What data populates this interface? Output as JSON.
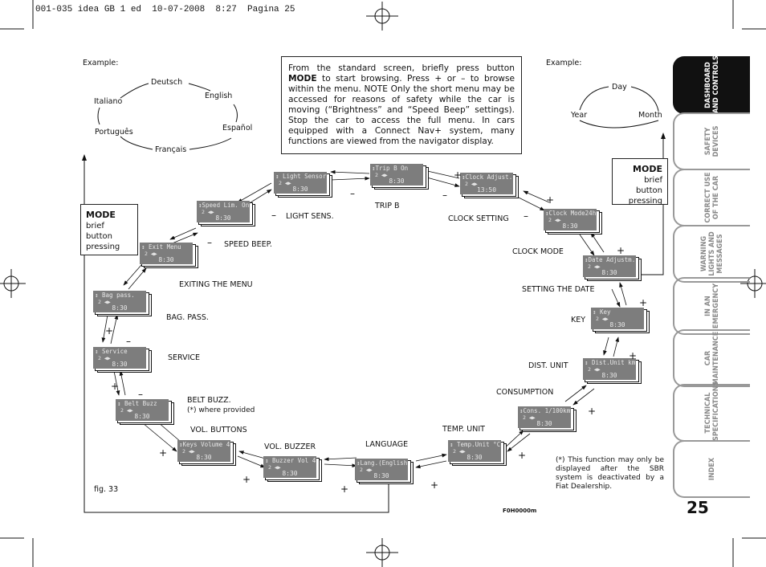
{
  "header": {
    "print_line": "001-035 idea GB 1 ed  10-07-2008  8:27  Pagina 25"
  },
  "info_box": {
    "text_before": "From the standard screen, briefly press button ",
    "mode": "MODE",
    "text_after": " to start browsing. Press + or – to browse within the menu. NOTE  Only the short menu may be accessed for reasons of safety while the car is moving (“Brightness” and “Speed Beep” settings). Stop the car to access the full menu. In cars equipped with a Connect Nav+ system, many functions are viewed from the navigator display."
  },
  "example_language": {
    "label": "Example:",
    "items": [
      "Deutsch",
      "English",
      "Español",
      "Français",
      "Português",
      "Italiano"
    ]
  },
  "example_date": {
    "label": "Example:",
    "items": [
      "Day",
      "Month",
      "Year"
    ]
  },
  "mode_boxes": [
    {
      "title": "MODE",
      "text": "brief button pressing"
    },
    {
      "title": "MODE",
      "text": "brief button pressing"
    }
  ],
  "displays": [
    {
      "id": "light-sensor",
      "line1": "↕ Light Sensor 2",
      "line2": "2 ◀▶",
      "time": "8:30",
      "caption": "LIGHT   SENS."
    },
    {
      "id": "trip-b",
      "line1": "↕Trip B      On",
      "line2": "2 ◀▶",
      "time": "8:30",
      "caption": "TRIP B"
    },
    {
      "id": "clock-adjust",
      "line1": "↕Clock Adjust.",
      "line2": "2 ◀▶",
      "time": "13:50",
      "caption": "CLOCK SETTING"
    },
    {
      "id": "clock-mode",
      "line1": "↕Clock Mode24h",
      "line2": "2 ◀▶",
      "time": "8:30",
      "caption": "CLOCK MODE"
    },
    {
      "id": "date-adjust",
      "line1": "↕Date Adjustm.",
      "line2": "2 ◀▶",
      "time": "8:30",
      "caption": "SETTING THE DATE"
    },
    {
      "id": "key",
      "line1": "↕       Key",
      "line2": "2 ◀▶",
      "time": "8:30",
      "caption": "KEY"
    },
    {
      "id": "dist-unit",
      "line1": "↕ Dist.Unit km",
      "line2": "2 ◀▶",
      "time": "8:30",
      "caption": "DIST. UNIT"
    },
    {
      "id": "consumption",
      "line1": "↕Cons. 1/100km",
      "line2": "2 ◀▶",
      "time": "8:30",
      "caption": "CONSUMPTION"
    },
    {
      "id": "temp-unit",
      "line1": "↕ Temp.Unit °C",
      "line2": "2 ◀▶",
      "time": "8:30",
      "caption": "TEMP. UNIT"
    },
    {
      "id": "language",
      "line1": "↕Lang.(English)",
      "line2": "2 ◀▶",
      "time": "8:30",
      "caption": "LANGUAGE"
    },
    {
      "id": "buzzer-vol",
      "line1": "↕ Buzzer Vol 4",
      "line2": "2 ◀▶",
      "time": "8:30",
      "caption": "VOL. BUZZER"
    },
    {
      "id": "keys-volume",
      "line1": "↕Keys Volume 4",
      "line2": "2 ◀▶",
      "time": "8:30",
      "caption": "VOL. BUTTONS"
    },
    {
      "id": "belt-buzz",
      "line1": "↕ Belt Buzz",
      "line2": "2 ◀▶",
      "time": "8:30",
      "caption": "BELT BUZZ.",
      "caption2": "(*) where provided"
    },
    {
      "id": "service",
      "line1": "↕   Service",
      "line2": "2 ◀▶",
      "time": "8:30",
      "caption": "SERVICE"
    },
    {
      "id": "bag-pass",
      "line1": "↕  Bag pass.",
      "line2": "2 ◀▶",
      "time": "8:30",
      "caption": "BAG. PASS."
    },
    {
      "id": "exit-menu",
      "line1": "↕  Exit Menu",
      "line2": "2 ◀▶",
      "time": "8:30",
      "caption": "EXITING THE MENU"
    },
    {
      "id": "speed-lim",
      "line1": "↕Speed Lim. On",
      "line2": "2 ◀▶",
      "time": "8:30",
      "caption": "SPEED BEEP."
    }
  ],
  "symbols": {
    "plus": "+",
    "minus": "–"
  },
  "figure": {
    "label": "fig. 33",
    "code": "F0H0000m"
  },
  "footnote": "(*) This function may only be displayed after the SBR system is deactivated by a Fiat Dealership.",
  "side_tabs": [
    {
      "label": "DASHBOARD\nAND CONTROLS",
      "active": true
    },
    {
      "label": "SAFETY\nDEVICES",
      "active": false
    },
    {
      "label": "CORRECT USE\nOF THE CAR",
      "active": false
    },
    {
      "label": "WARNING\nLIGHTS AND\nMESSAGES",
      "active": false
    },
    {
      "label": "IN AN\nEMERGENCY",
      "active": false
    },
    {
      "label": "CAR\nMAINTENANCE",
      "active": false
    },
    {
      "label": "TECHNICAL\nSPECIFICATIONS",
      "active": false
    },
    {
      "label": "INDEX",
      "active": false
    }
  ],
  "page_number": "25"
}
